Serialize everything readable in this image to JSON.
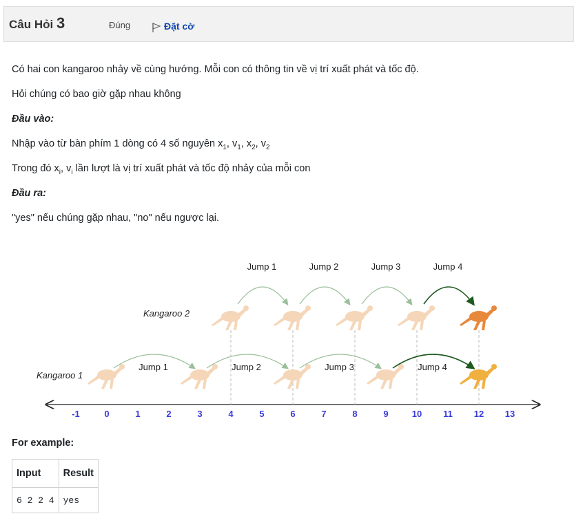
{
  "question": {
    "prefix": "Câu Hỏi",
    "number": "3",
    "state": "Đúng",
    "flag_label": "Đặt cờ"
  },
  "content": {
    "p1": "Có hai con kangaroo nhảy về cùng hướng. Mỗi con có thông tin về vị trí xuất phát và tốc độ.",
    "p2": "Hỏi chúng có bao giờ gặp nhau không",
    "input_heading": "Đầu vào:",
    "input_line_prefix": "Nhập vào từ bàn phím 1 dòng có 4 số nguyên ",
    "input_vars": [
      "x",
      "1",
      ", v",
      "1",
      ", x",
      "2",
      ", v",
      "2"
    ],
    "where_prefix": "Trong đó x",
    "where_sub_i": "i",
    "where_mid": ", v",
    "where_suffix": " lần lượt là vị trí xuất phát và tốc độ nhảy của mỗi con",
    "output_heading": "Đầu ra:",
    "output_line": "\"yes\" nếu chúng gặp nhau, \"no\" nếu ngược lại."
  },
  "diagram": {
    "kangaroo1_label": "Kangaroo 1",
    "kangaroo2_label": "Kangaroo 2",
    "top_jumps": [
      "Jump 1",
      "Jump 2",
      "Jump 3",
      "Jump 4"
    ],
    "bottom_jumps": [
      "Jump 1",
      "Jump 2",
      "Jump 3",
      "Jump 4"
    ],
    "axis_ticks": [
      "-1",
      "0",
      "1",
      "2",
      "3",
      "4",
      "5",
      "6",
      "7",
      "8",
      "9",
      "10",
      "11",
      "12",
      "13"
    ],
    "kangaroo1_positions": [
      0,
      3,
      6,
      9,
      12
    ],
    "kangaroo2_positions": [
      4,
      6,
      8,
      10,
      12
    ],
    "colors": {
      "kangaroo_light": "#f5d6b8",
      "kangaroo_dark": "#e8883a",
      "kangaroo1_last": "#f0b040",
      "tick": "#3b3bdc",
      "arrow_light": "#9bbf9b",
      "arrow_dark": "#1f5a1f"
    }
  },
  "example": {
    "title": "For example:",
    "headers": [
      "Input",
      "Result"
    ],
    "rows": [
      [
        "6 2 2 4",
        "yes"
      ]
    ]
  }
}
